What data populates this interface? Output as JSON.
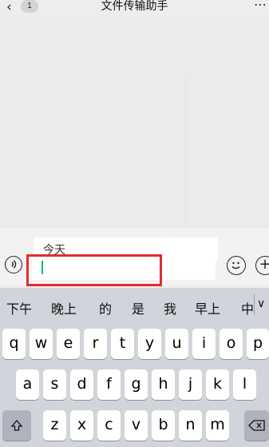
{
  "header": {
    "back_icon": "chevron-left-icon",
    "badge": "1",
    "title": "文件传输助手",
    "more_icon": "more-icon"
  },
  "compose": {
    "pending_text": "今天",
    "input_value": ""
  },
  "candidates": [
    "下午",
    "晚上",
    "的",
    "是",
    "我",
    "早上",
    "中"
  ],
  "keyboard": {
    "row1": [
      "q",
      "w",
      "e",
      "r",
      "t",
      "y",
      "u",
      "i",
      "o",
      "p"
    ],
    "row2": [
      "a",
      "s",
      "d",
      "f",
      "g",
      "h",
      "j",
      "k",
      "l"
    ],
    "row3": [
      "z",
      "x",
      "c",
      "v",
      "b",
      "n",
      "m"
    ],
    "shift_icon": "shift-icon",
    "delete_icon": "delete-icon"
  },
  "colors": {
    "highlight": "#e22d2d",
    "caret": "#07c160"
  }
}
